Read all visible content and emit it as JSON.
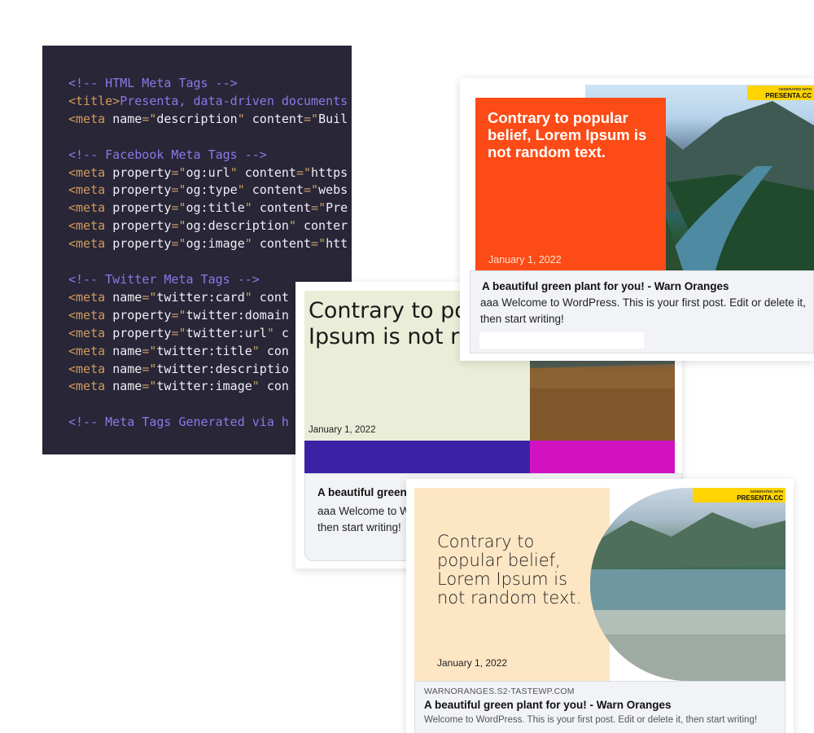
{
  "code": {
    "comment_html": "<!-- HTML Meta Tags -->",
    "title_line": {
      "tag": "<title>",
      "text": "Presenta, data-driven documents"
    },
    "desc_line": {
      "attr": "description",
      "content": "Buil"
    },
    "comment_fb": "<!-- Facebook Meta Tags -->",
    "fb": [
      {
        "prop": "og:url",
        "content": "https"
      },
      {
        "prop": "og:type",
        "content": "webs"
      },
      {
        "prop": "og:title",
        "content": "Pre"
      },
      {
        "prop": "og:description",
        "content": ""
      },
      {
        "prop": "og:image",
        "content": "htt"
      }
    ],
    "comment_tw": "<!-- Twitter Meta Tags -->",
    "tw": [
      {
        "kind": "name",
        "key": "twitter:card",
        "tail": " cont"
      },
      {
        "kind": "property",
        "key": "twitter:domain",
        "tail": ""
      },
      {
        "kind": "property",
        "key": "twitter:url",
        "tail": " c"
      },
      {
        "kind": "name",
        "key": "twitter:title",
        "tail": " con"
      },
      {
        "kind": "name",
        "key": "twitter:descriptio",
        "tail": ""
      },
      {
        "kind": "name",
        "key": "twitter:image",
        "tail": " con"
      }
    ],
    "comment_gen": "<!-- Meta Tags Generated via h"
  },
  "card_a": {
    "headline": "Contrary to popular belief, Lorem Ipsum is not random text.",
    "date": "January 1, 2022",
    "badge_small": "GENERATED WITH",
    "badge_big": "PRESENTA.CC",
    "meta_title": "A beautiful green plant for you! - Warn Oranges",
    "meta_desc": "aaa Welcome to WordPress. This is your first post. Edit or delete it, then start writing!",
    "colors": {
      "accent": "#fc4b16",
      "badge": "#ffd400"
    }
  },
  "card_b": {
    "headline": "Contrary to popular belief, Lorem Ipsum is not random text.",
    "date": "January 1, 2022",
    "meta_title": "A beautiful green plant for you! - Warn Oranges",
    "meta_desc": "aaa Welcome to WordPress. This is your first post. Edit or delete it, then start writing!",
    "colors": {
      "left": "#eaeed8",
      "purple": "#3b22a4",
      "magenta": "#d212c0"
    }
  },
  "card_c": {
    "headline": "Contrary to popular belief, Lorem Ipsum is not random text.",
    "date": "January 1, 2022",
    "badge_small": "GENERATED WITH",
    "badge_big": "PRESENTA.CC",
    "site": "WARNORANGES.S2-TASTEWP.COM",
    "meta_title": "A beautiful green plant for you! - Warn Oranges",
    "meta_desc": "Welcome to WordPress. This is your first post. Edit or delete it, then start writing!",
    "colors": {
      "panel": "#fde6c4",
      "badge": "#ffd400"
    }
  }
}
